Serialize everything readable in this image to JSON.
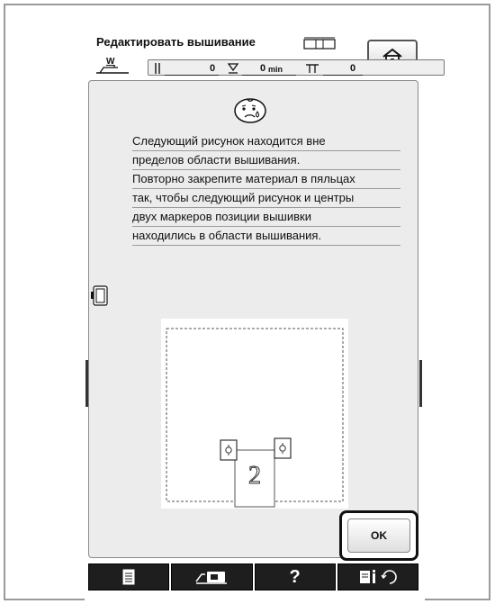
{
  "header": {
    "title": "Редактировать вышивание",
    "thread_label": "W",
    "stitch_count": "0",
    "time_value": "0",
    "time_unit": "min",
    "color_count": "0"
  },
  "dialog": {
    "message_lines": [
      "Следующий рисунок находится вне",
      "пределов области вышивания.",
      "Повторно закрепите материал в пяльцах",
      "так, чтобы следующий рисунок и центры",
      "двух маркеров позиции вышивки",
      "находились в области вышивания."
    ],
    "next_pattern_number": "2",
    "ok_label": "OK"
  },
  "toolbar": {
    "help_label": "?"
  },
  "icons": {
    "home": "home-icon",
    "face": "sad-face-icon",
    "hoop": "embroidery-frame-icon",
    "frame": "frame-indicator-icon",
    "document": "document-icon",
    "camera": "camera-icon",
    "settings": "settings-refresh-icon"
  },
  "colors": {
    "dialog_background": "#ececec",
    "toolbar_background": "#1e1e1e",
    "preview_background": "#ffffff"
  }
}
